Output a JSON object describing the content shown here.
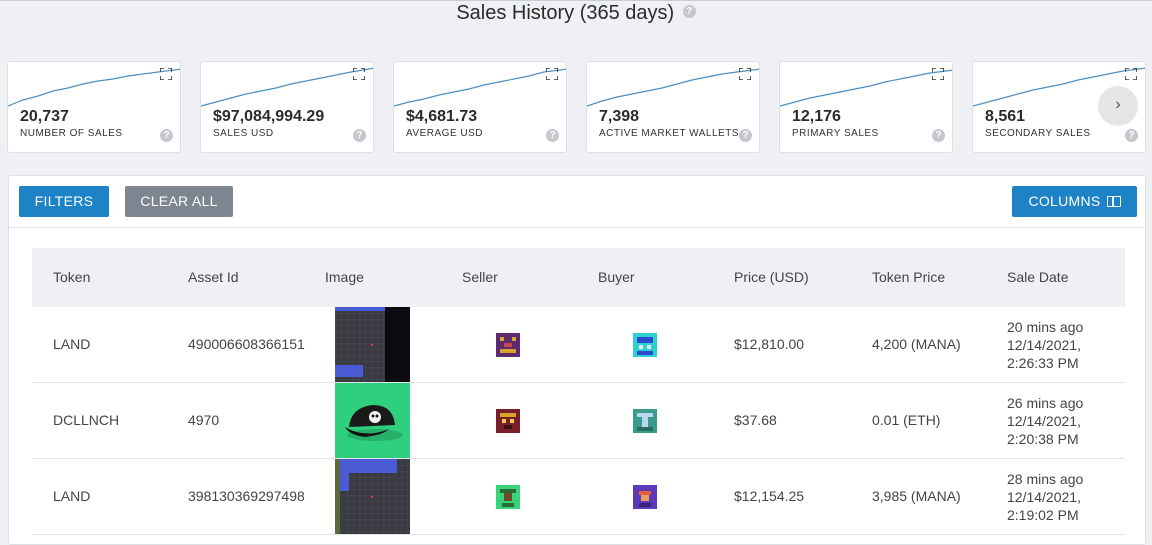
{
  "header": {
    "title": "Sales History (365 days)",
    "help": "?"
  },
  "stats": [
    {
      "value": "20,737",
      "label": "NUMBER OF SALES"
    },
    {
      "value": "$97,084,994.29",
      "label": "SALES USD"
    },
    {
      "value": "$4,681.73",
      "label": "AVERAGE USD"
    },
    {
      "value": "7,398",
      "label": "ACTIVE MARKET WALLETS"
    },
    {
      "value": "12,176",
      "label": "PRIMARY SALES"
    },
    {
      "value": "8,561",
      "label": "SECONDARY SALES"
    }
  ],
  "carousel": {
    "next": "›"
  },
  "toolbar": {
    "filters": "FILTERS",
    "clear_all": "CLEAR ALL",
    "columns": "COLUMNS"
  },
  "table": {
    "columns": [
      "Token",
      "Asset Id",
      "Image",
      "Seller",
      "Buyer",
      "Price (USD)",
      "Token Price",
      "Sale Date"
    ],
    "rows": [
      {
        "token": "LAND",
        "asset_id": "490006608366151",
        "price_usd": "$12,810.00",
        "token_price": "4,200 (MANA)",
        "date_ago": "20 mins ago",
        "date": "12/14/2021,",
        "time": "2:26:33 PM"
      },
      {
        "token": "DCLLNCH",
        "asset_id": "4970",
        "price_usd": "$37.68",
        "token_price": "0.01 (ETH)",
        "date_ago": "26 mins ago",
        "date": "12/14/2021,",
        "time": "2:20:38 PM"
      },
      {
        "token": "LAND",
        "asset_id": "398130369297498",
        "price_usd": "$12,154.25",
        "token_price": "3,985 (MANA)",
        "date_ago": "28 mins ago",
        "date": "12/14/2021,",
        "time": "2:19:02 PM"
      }
    ]
  },
  "colors": {
    "primary": "#1e83c6",
    "secondary": "#7d8690",
    "spark": "#4f8fbf"
  }
}
